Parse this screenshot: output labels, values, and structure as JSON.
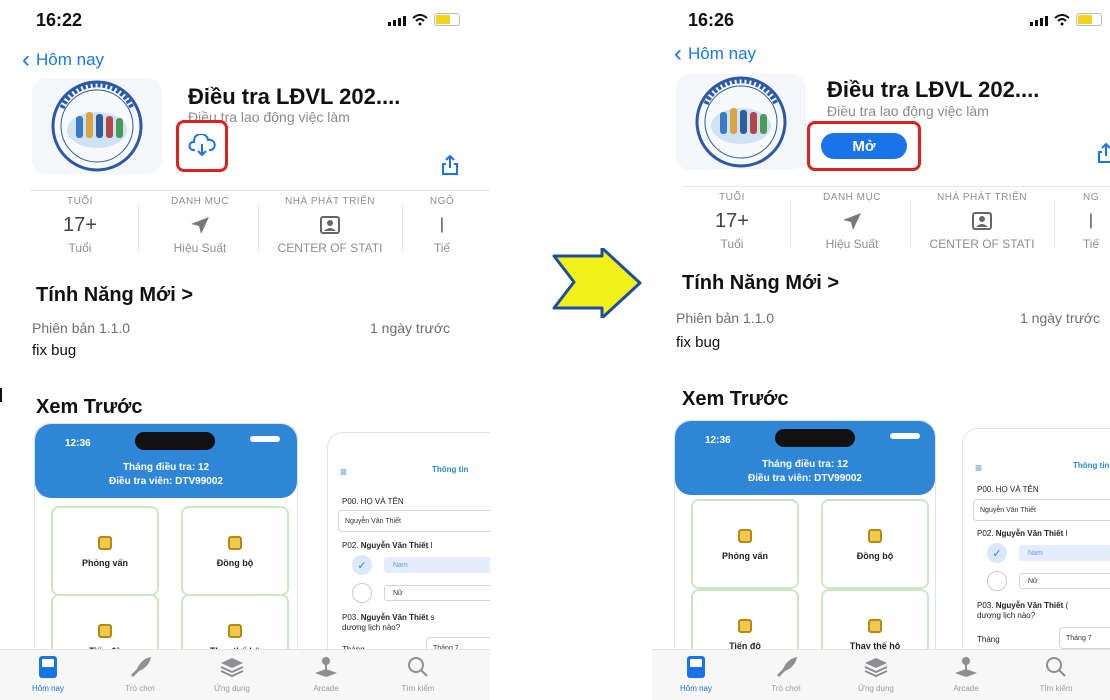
{
  "left": {
    "status": {
      "time": "16:22"
    },
    "nav": {
      "back_label": "Hôm nay"
    },
    "app": {
      "name": "Điều tra LĐVL 202....",
      "subtitle": "Điều tra lao động việc làm"
    },
    "info": {
      "age": {
        "title": "TUỔI",
        "value": "17+",
        "sub": "Tuổi"
      },
      "category": {
        "title": "DANH MỤC",
        "sub": "Hiệu Suất"
      },
      "developer": {
        "title": "NHÀ PHÁT TRIỂN",
        "sub": "CENTER OF STATI"
      },
      "language": {
        "title": "NGÔ",
        "sub": "Tiế"
      }
    },
    "whats_new": {
      "title": "Tính Năng Mới >",
      "version": "Phiên bản 1.1.0",
      "when": "1 ngày trước",
      "notes": "fix bug"
    },
    "preview": {
      "title": "Xem Trước",
      "clock": "12:36",
      "header_line1": "Tháng điều tra: 12",
      "header_line2": "Điều tra viên: DTV99002",
      "tiles": [
        "Phỏng vấn",
        "Đồng bộ",
        "Tiến độ",
        "Thay thế hộ"
      ],
      "form": {
        "menu": "≡",
        "title": "Thông tin",
        "q0": "P00. HỌ VÀ TÊN",
        "q0_value": "Nguyễn Văn Thiết",
        "q2_prefix": "P02. ",
        "q2_name": "Nguyễn Văn Thiết",
        "q2_suffix": " l",
        "opt_male": "Nam",
        "opt_female": "Nữ",
        "q3_prefix": "P03. ",
        "q3_name": "Nguyễn Văn Thiết",
        "q3_suffix": " s",
        "q3_line2": "dương lịch nào?",
        "month_label": "Tháng",
        "month_value": "Tháng 7"
      }
    },
    "tabs": [
      "Hôm nay",
      "Trò chơi",
      "Ứng dụng",
      "Arcade",
      "Tìm kiếm"
    ]
  },
  "right": {
    "status": {
      "time": "16:26"
    },
    "nav": {
      "back_label": "Hôm nay"
    },
    "app": {
      "name": "Điều tra LĐVL 202....",
      "subtitle": "Điều tra lao động việc làm",
      "open_label": "Mở"
    },
    "info": {
      "age": {
        "title": "TUỔI",
        "value": "17+",
        "sub": "Tuổi"
      },
      "category": {
        "title": "DANH MỤC",
        "sub": "Hiệu Suất"
      },
      "developer": {
        "title": "NHÀ PHÁT TRIỂN",
        "sub": "CENTER OF STATI"
      },
      "language": {
        "title": "NG",
        "sub": "Tiế"
      }
    },
    "whats_new": {
      "title": "Tính Năng Mới >",
      "version": "Phiên bản 1.1.0",
      "when": "1 ngày trước",
      "notes": "fix bug"
    },
    "preview": {
      "title": "Xem Trước",
      "clock": "12:36",
      "header_line1": "Tháng điều tra: 12",
      "header_line2": "Điều tra viên: DTV99002",
      "tiles": [
        "Phỏng vấn",
        "Đồng bộ",
        "Tiến độ",
        "Thay thế hộ"
      ],
      "form": {
        "menu": "≡",
        "title": "Thông tin",
        "q0": "P00. HỌ VÀ TÊN",
        "q0_value": "Nguyễn Văn Thiết",
        "q2_prefix": "P02. ",
        "q2_name": "Nguyễn Văn Thiết",
        "q2_suffix": " l",
        "opt_male": "Nam",
        "opt_female": "Nữ",
        "q3_prefix": "P03. ",
        "q3_name": "Nguyễn Văn Thiết",
        "q3_suffix": " (",
        "q3_line2": "dương lịch nào?",
        "month_label": "Tháng",
        "month_value": "Tháng 7"
      }
    },
    "tabs": [
      "Hôm nay",
      "Trò chơi",
      "Ứng dụng",
      "Arcade",
      "Tìm kiếm"
    ]
  },
  "colors": {
    "accent": "#1a73e8",
    "highlight": "#e0201c",
    "arrow_fill": "#f2f21a",
    "arrow_stroke": "#1f4e9c",
    "tile_border": "#cde7c6",
    "preview_header": "#2f86d6"
  }
}
